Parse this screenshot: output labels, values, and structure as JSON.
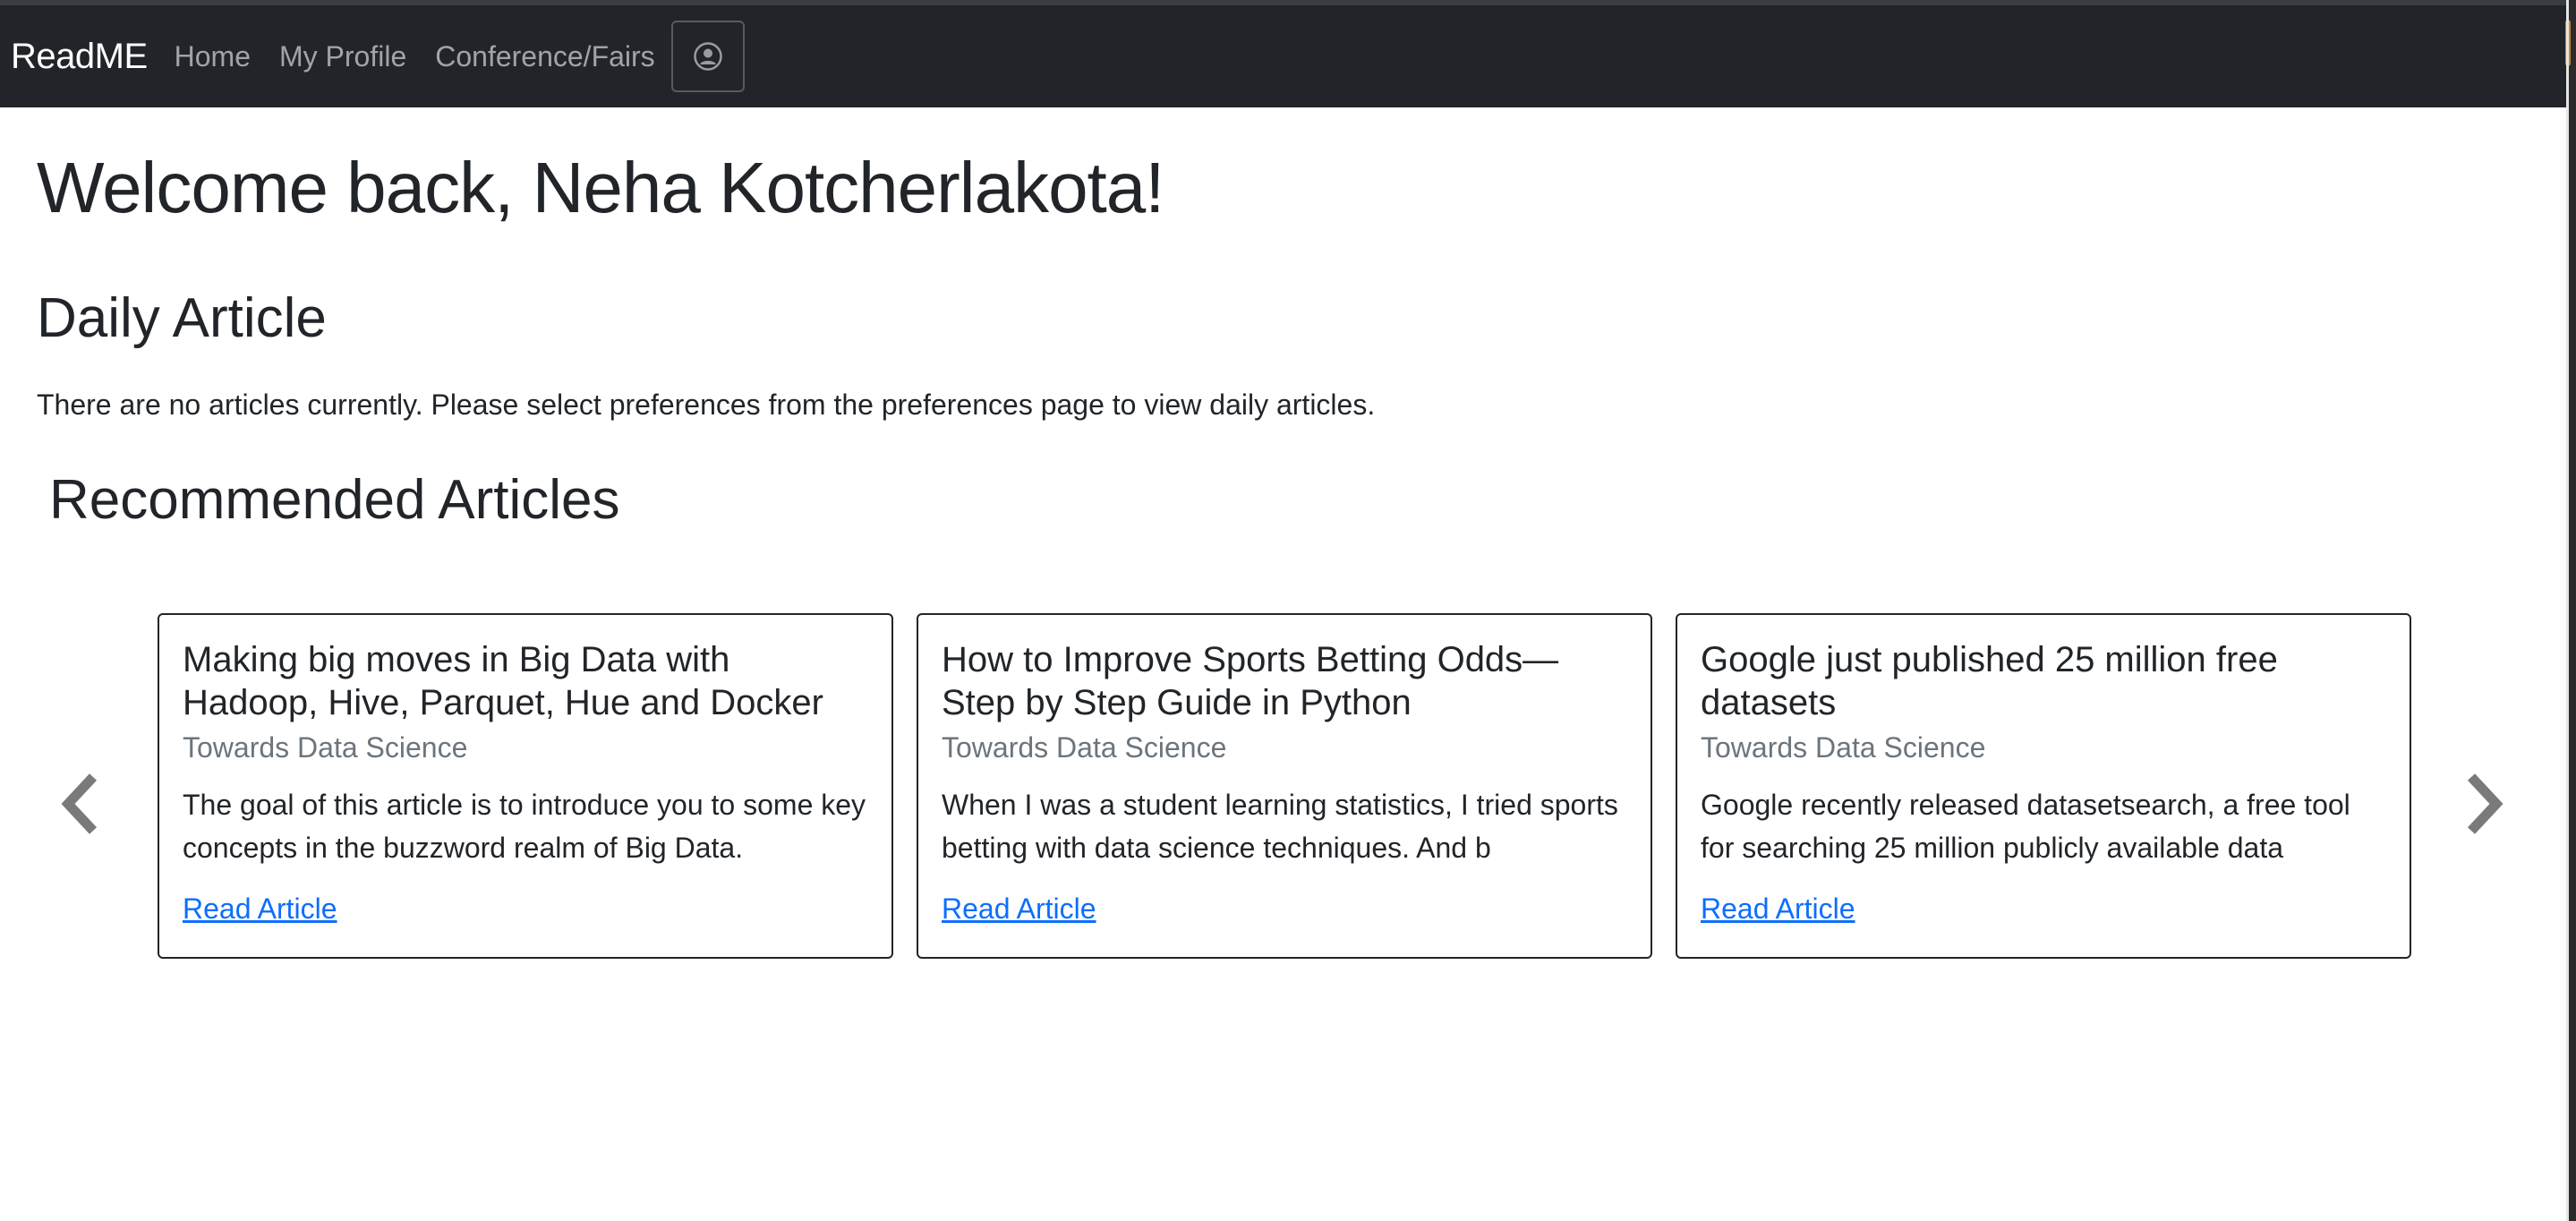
{
  "navbar": {
    "brand": "ReadME",
    "links": [
      "Home",
      "My Profile",
      "Conference/Fairs"
    ],
    "profile_icon": "user-circle-icon"
  },
  "main": {
    "welcome": "Welcome back, Neha Kotcherlakota!",
    "daily_title": "Daily Article",
    "daily_empty": "There are no articles currently. Please select preferences from the preferences page to view daily articles.",
    "recommended_title": "Recommended Articles"
  },
  "carousel": {
    "prev_icon": "chevron-left-icon",
    "next_icon": "chevron-right-icon",
    "cards": [
      {
        "title": "Making big moves in Big Data with Hadoop, Hive, Parquet, Hue and Docker",
        "source": "Towards Data Science",
        "text": "The goal of this article is to introduce you to some key concepts in the buzzword realm of Big Data.",
        "link": "Read Article"
      },
      {
        "title": "How to Improve Sports Betting Odds— Step by Step Guide in Python",
        "source": "Towards Data Science",
        "text": "When I was a student learning statistics, I tried sports betting with data science techniques. And b",
        "link": "Read Article"
      },
      {
        "title": "Google just published 25 million free datasets",
        "source": "Towards Data Science",
        "text": "Google recently released datasetsearch, a free tool for searching 25 million publicly available data",
        "link": "Read Article"
      }
    ]
  },
  "colors": {
    "navbar_bg": "#212529",
    "link": "#0d6efd",
    "muted": "#6c757d",
    "arrow": "#7a7a7a"
  }
}
